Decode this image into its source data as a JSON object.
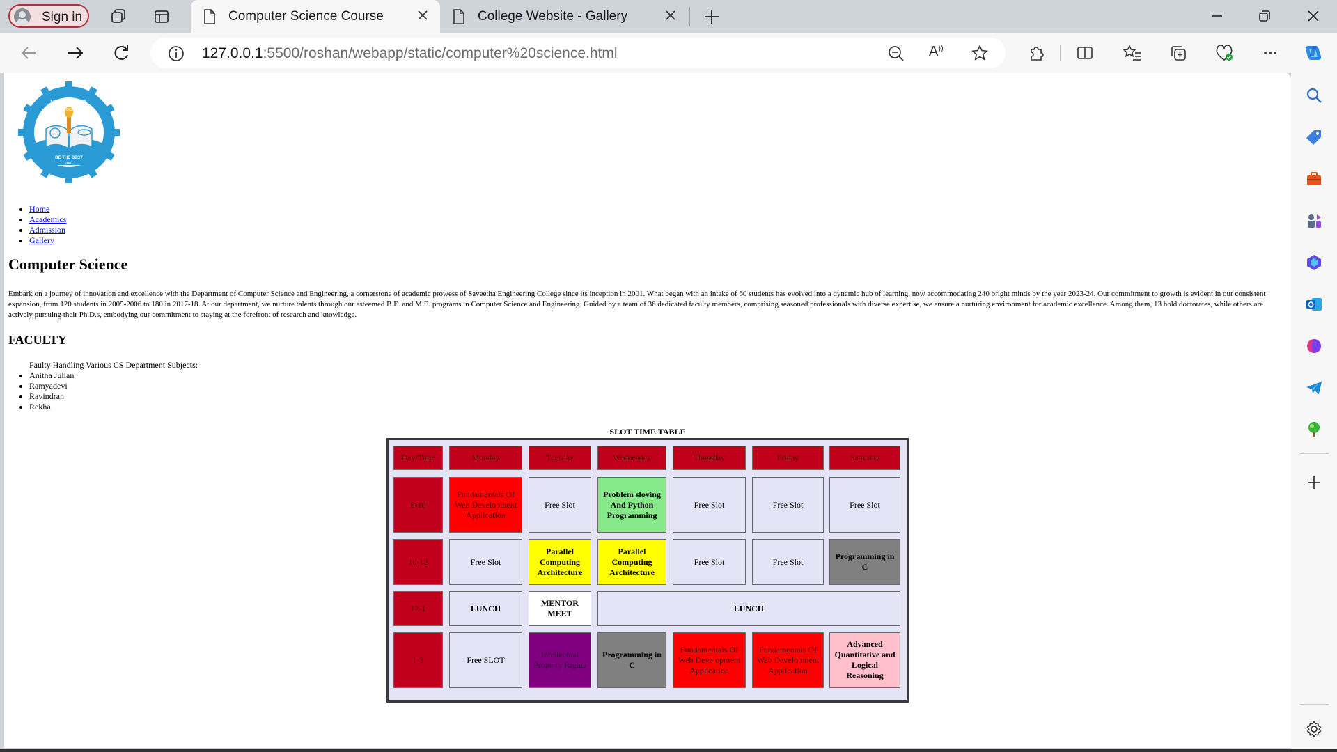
{
  "browser": {
    "sign_in_label": "Sign in",
    "tabs": [
      {
        "title": "Computer Science Course",
        "active": true
      },
      {
        "title": "College Website - Gallery",
        "active": false
      }
    ],
    "url_host": "127.0.0.1",
    "url_path": ":5500/roshan/webapp/static/computer%20science.html"
  },
  "logo": {
    "top_text": "SAVEETHA",
    "sub_text": "ENGINEERING COLLEGE",
    "motto": "BE THE BEST",
    "year": "2001"
  },
  "nav": [
    "Home",
    "Academics",
    "Admission",
    "Gallery"
  ],
  "page": {
    "title": "Computer Science",
    "intro": "Embark on a journey of innovation and excellence with the Department of Computer Science and Engineering, a cornerstone of academic prowess of Saveetha Engineering College since its inception in 2001. What began with an intake of 60 students has evolved into a dynamic hub of learning, now accommodating 240 bright minds by the year 2023-24. Our commitment to growth is evident in our consistent expansion, from 120 students in 2005-2006 to 180 in 2017-18. At our department, we nurture talents through our esteemed B.E. and M.E. programs in Computer Science and Engineering. Guided by a team of 36 dedicated faculty members, comprising seasoned professionals with diverse expertise, we ensure a nurturing environment for academic excellence. Among them, 13 hold doctorates, while others are actively pursuing their Ph.D.s, embodying our commitment to staying at the forefront of research and knowledge.",
    "faculty_heading": "FACULTY",
    "faculty_caption": "Faulty Handling Various CS Department Subjects:",
    "faculty": [
      "Anitha Julian",
      "Ramyadevi",
      "Ravindran",
      "Rekha"
    ]
  },
  "timetable": {
    "title": "SLOT TIME TABLE",
    "header": [
      "Day/Time",
      "Monday",
      "Tuesday",
      "Wednesday",
      "Thursday",
      "Friday",
      "Saturday"
    ],
    "rows": [
      {
        "time": "8-10",
        "cells": [
          {
            "text": "Fundamentals Of Web Development Application",
            "color": "#ff0000"
          },
          {
            "text": "Free Slot",
            "color": "#e4e4f6"
          },
          {
            "text": "Problem sloving And Python Programming",
            "color": "#86e98a"
          },
          {
            "text": "Free Slot",
            "color": "#e4e4f6"
          },
          {
            "text": "Free Slot",
            "color": "#e4e4f6"
          },
          {
            "text": "Free Slot",
            "color": "#e4e4f6"
          }
        ]
      },
      {
        "time": "10-12",
        "cells": [
          {
            "text": "Free Slot",
            "color": "#e4e4f6"
          },
          {
            "text": "Parallel Computing Architecture",
            "color": "#ffff00"
          },
          {
            "text": "Parallel Computing Architecture",
            "color": "#ffff00"
          },
          {
            "text": "Free Slot",
            "color": "#e4e4f6"
          },
          {
            "text": "Free Slot",
            "color": "#e4e4f6"
          },
          {
            "text": "Programming in C",
            "color": "#808080"
          }
        ]
      },
      {
        "time": "12-1",
        "cells": [
          {
            "text": "LUNCH",
            "color": "#e4e4f6"
          },
          {
            "text": "MENTOR MEET",
            "color": "#ffffff"
          },
          {
            "text": "LUNCH",
            "color": "#e4e4f6",
            "span": 4
          }
        ]
      },
      {
        "time": "1-3",
        "cells": [
          {
            "text": "Free SLOT",
            "color": "#e4e4f6"
          },
          {
            "text": "Intellectual Property Rights",
            "color": "#800080"
          },
          {
            "text": "Programming in C",
            "color": "#808080"
          },
          {
            "text": "Fundamentals Of Web Development Application",
            "color": "#ff0000"
          },
          {
            "text": "Fundamentals Of Web Development Application",
            "color": "#ff0000"
          },
          {
            "text": "Advanced Quantitative and Logical Reasoning",
            "color": "#ffc0cb"
          }
        ]
      }
    ]
  },
  "icons": {
    "tab_actions": "workspaces-icon",
    "tab_vertical": "vertical-tabs-icon",
    "sidebar": [
      "search-icon",
      "shopping-tag-icon",
      "toolbox-icon",
      "games-icon",
      "copilot-apps-icon",
      "outlook-icon",
      "drop-icon",
      "telegram-icon",
      "tree-icon",
      "add-icon",
      "settings-icon"
    ]
  }
}
